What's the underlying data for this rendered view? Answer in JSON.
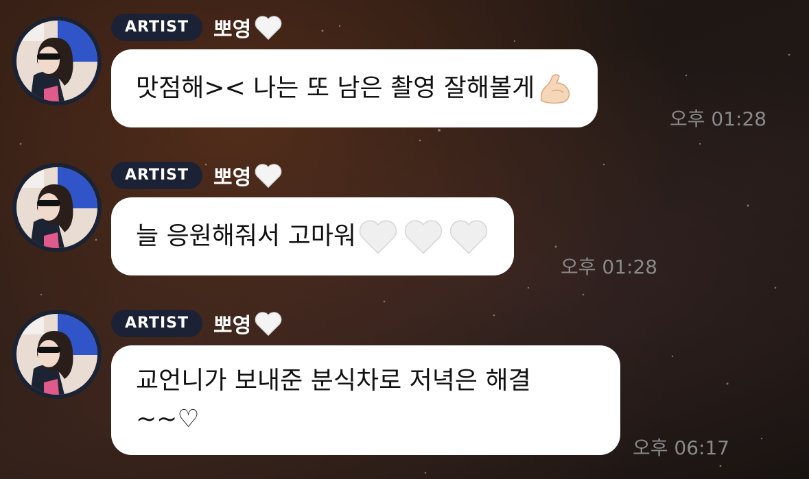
{
  "messages": [
    {
      "badge": "ARTIST",
      "name": "뽀영",
      "name_icon": "white-heart-icon",
      "text": "맛점해>< 나는 또 남은 촬영 잘해볼게",
      "trailing_icons": [
        "flexed-biceps-icon"
      ],
      "time": "오후 01:28"
    },
    {
      "badge": "ARTIST",
      "name": "뽀영",
      "name_icon": "white-heart-icon",
      "text": "늘 응원해줘서 고마워",
      "trailing_icons": [
        "white-heart-icon",
        "white-heart-icon",
        "white-heart-icon"
      ],
      "time": "오후 01:28"
    },
    {
      "badge": "ARTIST",
      "name": "뽀영",
      "name_icon": "white-heart-icon",
      "text": "교언니가 보내준 분식차로 저녁은 해결\n~~♡",
      "trailing_icons": [],
      "time": "오후 06:17"
    }
  ],
  "colors": {
    "bubble": "#ffffff",
    "badge": "#1b2236",
    "timestamp": "#8a8a8a"
  }
}
